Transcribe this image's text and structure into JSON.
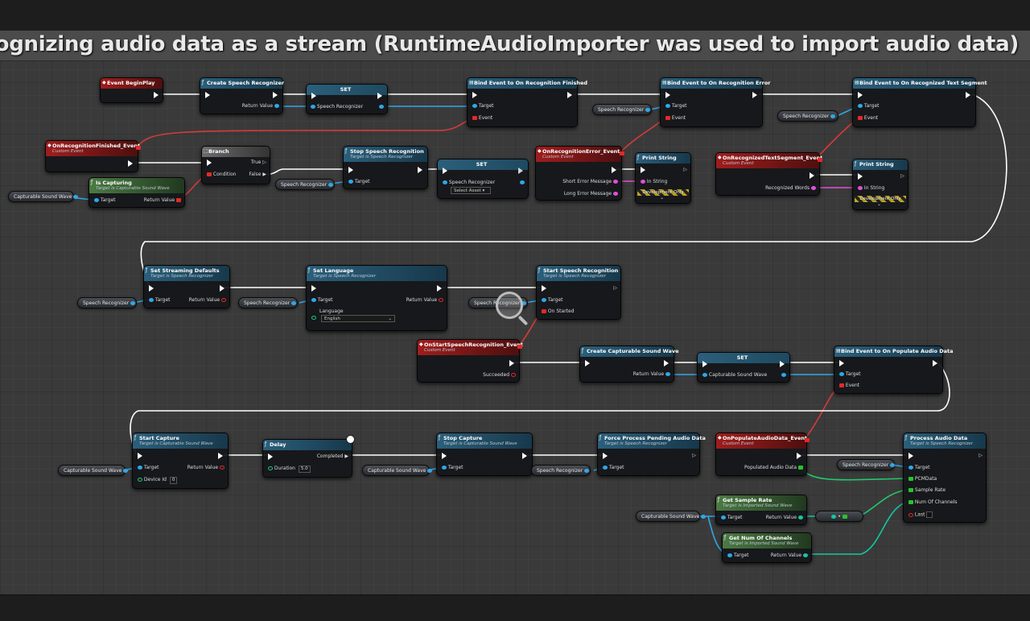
{
  "comment": {
    "title": "n example of recognizing audio data as a stream (RuntimeAudioImporter was used to import audio data)"
  },
  "colors": {
    "exec_wire": "#ffffff",
    "object_wire": "#2fa7e8",
    "delegate_wire": "#d63a3a",
    "array_wire": "#22c86d",
    "float_wire": "#12c9a0"
  },
  "nodes": {
    "event_begin_play": {
      "title": "Event BeginPlay"
    },
    "create_speech_recognizer": {
      "title": "Create Speech Recognizer",
      "out": "Return Value"
    },
    "set_1": {
      "title": "SET",
      "pin": "Speech Recognizer"
    },
    "bind_finished": {
      "title": "Bind Event to On Recognition Finished",
      "pin_target": "Target",
      "pin_event": "Event"
    },
    "bind_error": {
      "title": "Bind Event to On Recognition Error",
      "pin_target": "Target",
      "pin_event": "Event"
    },
    "bind_segment": {
      "title": "Bind Event to On Recognized Text Segment",
      "pin_target": "Target",
      "pin_event": "Event"
    },
    "on_finished_event": {
      "title": "OnRecognitionFinished_Event",
      "subtitle": "Custom Event"
    },
    "branch": {
      "title": "Branch",
      "true": "True",
      "false": "False",
      "condition": "Condition"
    },
    "is_capturing": {
      "title": "Is Capturing",
      "subtitle": "Target is Capturable Sound Wave",
      "target": "Target",
      "out": "Return Value"
    },
    "stop_speech_recognition": {
      "title": "Stop Speech Recognition",
      "subtitle": "Target is Speech Recognizer",
      "target": "Target"
    },
    "set_2": {
      "title": "SET",
      "pin": "Speech Recognizer",
      "select": "Select Asset"
    },
    "on_error_event": {
      "title": "OnRecognitionError_Event",
      "subtitle": "Custom Event",
      "short": "Short Error Message",
      "long": "Long Error Message"
    },
    "print_string_1": {
      "title": "Print String",
      "in": "In String",
      "dev": "Development Only"
    },
    "on_segment_event": {
      "title": "OnRecognizedTextSegment_Event",
      "subtitle": "Custom Event",
      "words": "Recognized Words"
    },
    "print_string_2": {
      "title": "Print String",
      "in": "In String",
      "dev": "Development Only"
    },
    "set_streaming_defaults": {
      "title": "Set Streaming Defaults",
      "subtitle": "Target is Speech Recognizer",
      "target": "Target",
      "out": "Return Value"
    },
    "set_language": {
      "title": "Set Language",
      "subtitle": "Target is Speech Recognizer",
      "target": "Target",
      "language": "Language",
      "language_value": "English",
      "out": "Return Value"
    },
    "start_speech_recognition": {
      "title": "Start Speech Recognition",
      "subtitle": "Target is Speech Recognizer",
      "target": "Target",
      "on_started": "On Started"
    },
    "on_start_event": {
      "title": "OnStartSpeechRecognition_Event",
      "subtitle": "Custom Event",
      "succeeded": "Succeeded"
    },
    "create_capturable": {
      "title": "Create Capturable Sound Wave",
      "out": "Return Value"
    },
    "set_3": {
      "title": "SET",
      "pin": "Capturable Sound Wave"
    },
    "bind_populate": {
      "title": "Bind Event to On Populate Audio Data",
      "pin_target": "Target",
      "pin_event": "Event"
    },
    "start_capture": {
      "title": "Start Capture",
      "subtitle": "Target is Capturable Sound Wave",
      "target": "Target",
      "device": "Device Id",
      "device_value": "0",
      "out": "Return Value"
    },
    "delay": {
      "title": "Delay",
      "completed": "Completed",
      "duration": "Duration",
      "duration_value": "5.0"
    },
    "stop_capture": {
      "title": "Stop Capture",
      "subtitle": "Target is Capturable Sound Wave",
      "target": "Target"
    },
    "force_process": {
      "title": "Force Process Pending Audio Data",
      "subtitle": "Target is Speech Recognizer",
      "target": "Target"
    },
    "on_populate_event": {
      "title": "OnPopulateAudioData_Event",
      "subtitle": "Custom Event",
      "data": "Populated Audio Data"
    },
    "process_audio": {
      "title": "Process Audio Data",
      "subtitle": "Target is Speech Recognizer",
      "target": "Target",
      "pcm": "PCMData",
      "rate": "Sample Rate",
      "channels": "Num Of Channels",
      "last": "Last"
    },
    "get_sample_rate": {
      "title": "Get Sample Rate",
      "subtitle": "Target is Imported Sound Wave",
      "target": "Target",
      "out": "Return Value"
    },
    "get_num_channels": {
      "title": "Get Num Of Channels",
      "subtitle": "Target is Imported Sound Wave",
      "target": "Target",
      "out": "Return Value"
    }
  },
  "variables": {
    "speech_recognizer": "Speech Recognizer",
    "capturable_sound_wave": "Capturable Sound Wave"
  }
}
